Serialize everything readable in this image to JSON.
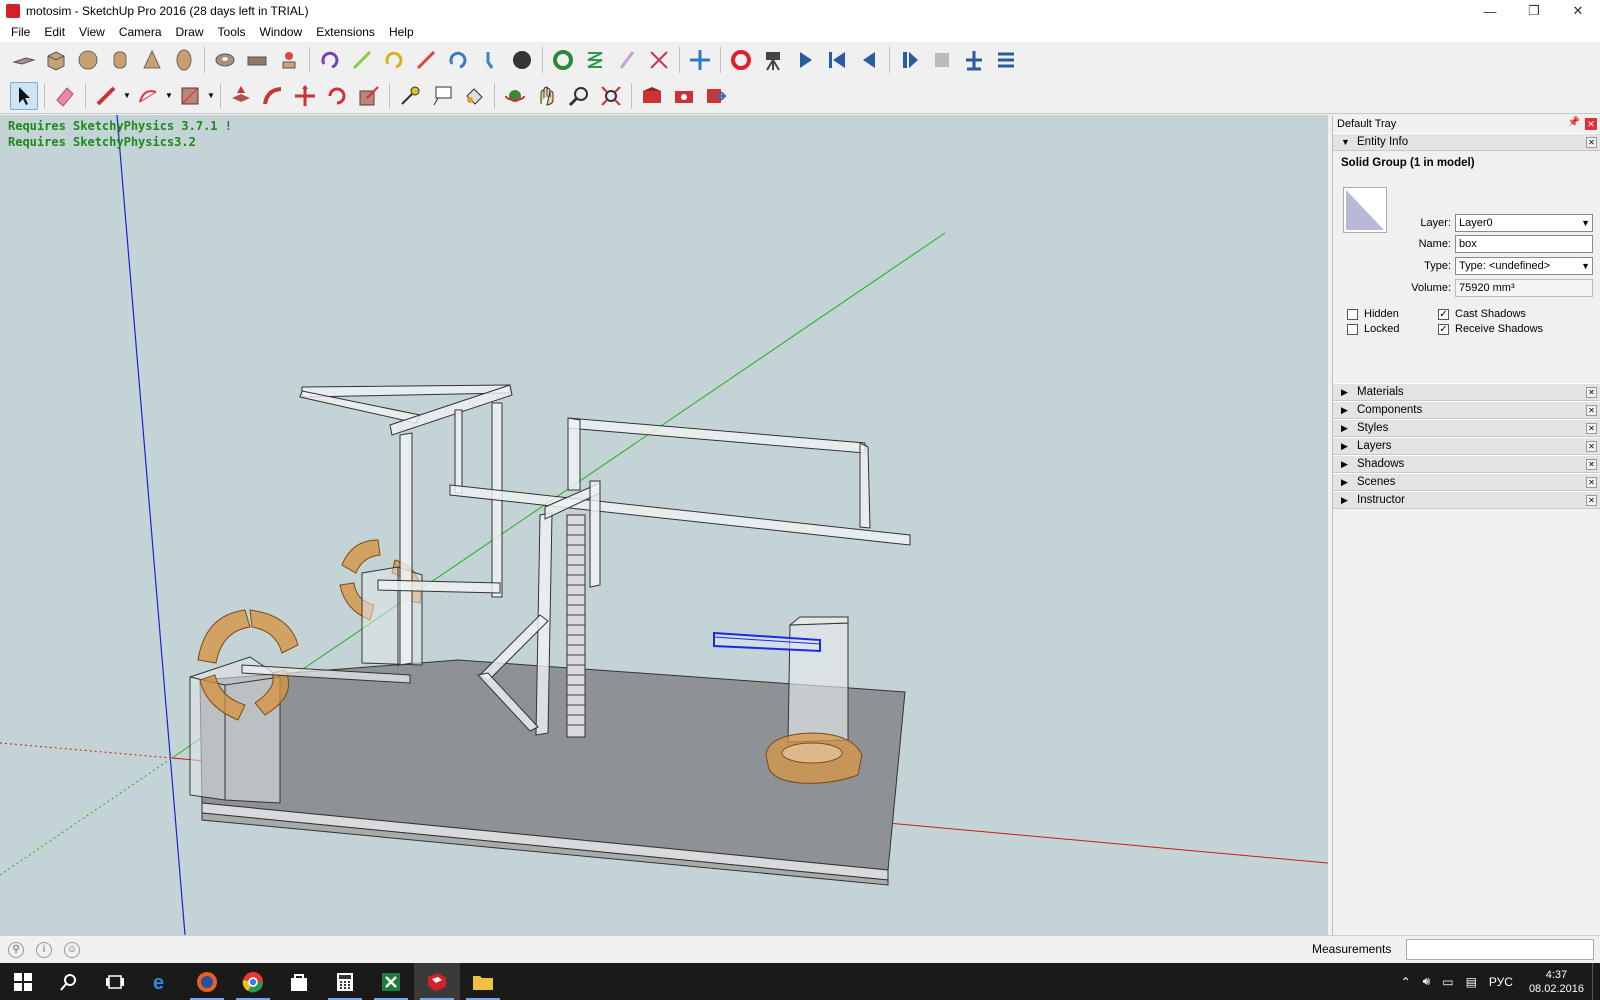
{
  "window": {
    "title": "motosim - SketchUp Pro 2016 (28 days left in TRIAL)",
    "controls": {
      "minimize": "—",
      "restore": "❐",
      "close": "✕"
    }
  },
  "menu": [
    "File",
    "Edit",
    "View",
    "Camera",
    "Draw",
    "Tools",
    "Window",
    "Extensions",
    "Help"
  ],
  "toolbar1": {
    "icons": [
      "plane-icon",
      "box-icon",
      "sphere-icon",
      "cylinder-icon",
      "cone-icon",
      "ellipsoid-icon",
      "torus-icon",
      "rope-icon",
      "joint-icon",
      "hinge-icon",
      "slider-icon",
      "piston-icon",
      "servo-icon",
      "spring-icon",
      "magnet-icon",
      "fixed-joint-icon",
      "gear-joint-icon",
      "sphere-solid-icon",
      "refresh-icon",
      "spring-s-icon",
      "wand-icon",
      "cross-icon",
      "move-cross-icon",
      "record-icon",
      "camera-tripod-icon",
      "play-icon",
      "rewind-icon",
      "step-back-icon",
      "pause-icon",
      "stop-icon",
      "add-icon",
      "menu-icon"
    ]
  },
  "toolbar2": {
    "icons": [
      "select-icon",
      "eraser-icon",
      "pencil-icon",
      "arc-icon",
      "rectangle-icon",
      "push-pull-icon",
      "follow-me-icon",
      "move-icon",
      "rotate-icon",
      "scale-icon",
      "tape-measure-icon",
      "text-icon",
      "paint-bucket-icon",
      "orbit-icon",
      "pan-icon",
      "zoom-icon",
      "zoom-extents-icon",
      "warehouse-icon",
      "extension-warehouse-icon",
      "share-model-icon"
    ]
  },
  "viewport": {
    "messages": [
      "Requires SketchyPhysics 3.7.1 !",
      "Requires SketchyPhysics3.2"
    ],
    "background": "#c4d3d5"
  },
  "tray": {
    "title": "Default Tray",
    "entity_info": {
      "header": "Entity Info",
      "subtitle": "Solid Group (1 in model)",
      "layer_label": "Layer:",
      "layer_value": "Layer0",
      "name_label": "Name:",
      "name_value": "box",
      "type_label": "Type:",
      "type_value": "Type: <undefined>",
      "volume_label": "Volume:",
      "volume_value": "75920 mm³",
      "hidden_label": "Hidden",
      "locked_label": "Locked",
      "cast_label": "Cast Shadows",
      "receive_label": "Receive Shadows",
      "hidden": false,
      "locked": false,
      "cast_shadows": true,
      "receive_shadows": true
    },
    "panels": [
      "Materials",
      "Components",
      "Styles",
      "Layers",
      "Shadows",
      "Scenes",
      "Instructor"
    ]
  },
  "statusbar": {
    "measurements_label": "Measurements",
    "measurements_value": ""
  },
  "taskbar": {
    "apps": [
      "start-icon",
      "search-icon",
      "task-view-icon",
      "edge-icon",
      "firefox-icon",
      "chrome-icon",
      "store-icon",
      "calculator-icon",
      "excel-icon",
      "sketchup-icon",
      "file-explorer-icon"
    ],
    "lang": "РУС",
    "time": "4:37",
    "date": "08.02.2016"
  }
}
